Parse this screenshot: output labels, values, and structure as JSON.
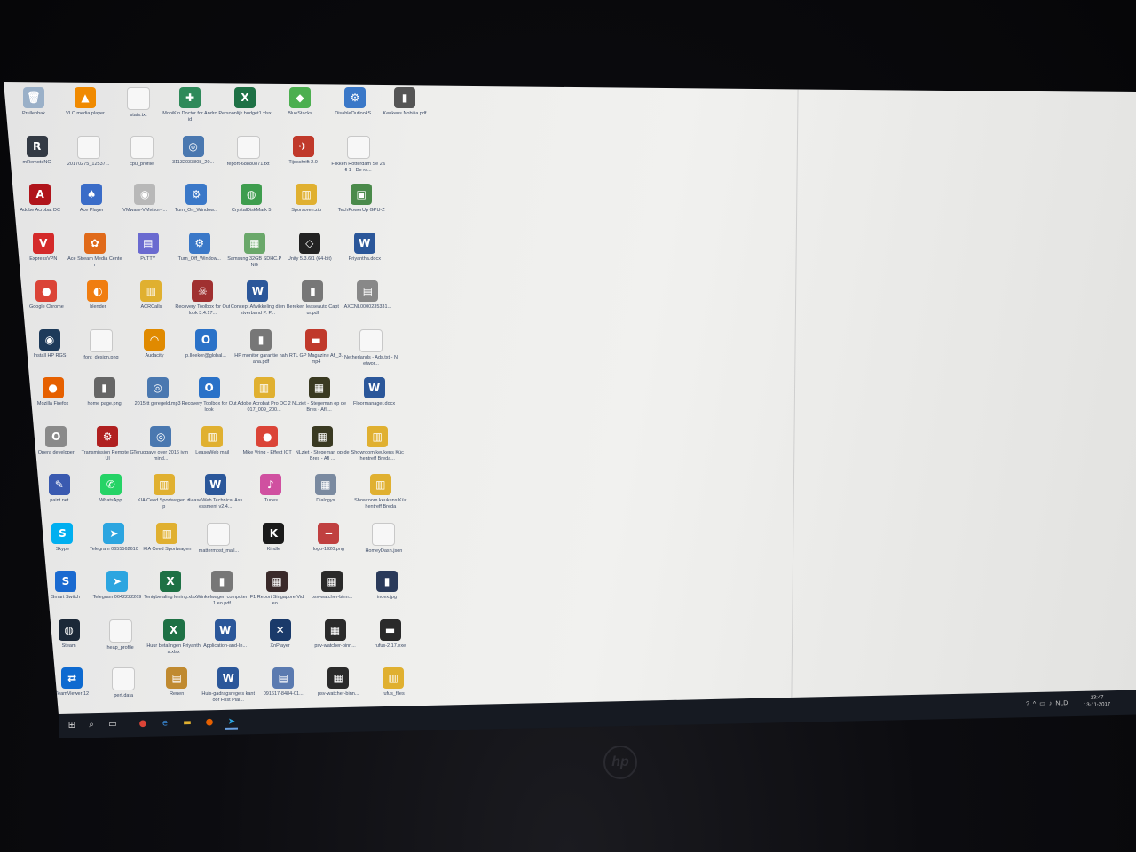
{
  "desktop": {
    "icons": [
      {
        "label": "Prullenbak",
        "glyph": "🗑",
        "color": "#9ab0c8"
      },
      {
        "label": "VLC media player",
        "glyph": "▲",
        "color": "#f08a00"
      },
      {
        "label": "stats.txt",
        "glyph": "",
        "color": "#d8d8d8"
      },
      {
        "label": "MobiKin Doctor for Android",
        "glyph": "✚",
        "color": "#2f8a5a"
      },
      {
        "label": "Persoonlijk budget1.xlsx",
        "glyph": "X",
        "color": "#1e7145"
      },
      {
        "label": "BlueStacks",
        "glyph": "◆",
        "color": "#4caf50"
      },
      {
        "label": "DisableOutlookS...",
        "glyph": "⚙",
        "color": "#3a78c8"
      },
      {
        "label": "Keukens Nobilia.pdf",
        "glyph": "▮",
        "color": "#555555"
      },
      {
        "label": "mRemoteNG",
        "glyph": "R",
        "color": "#333a44"
      },
      {
        "label": "20170275_12537...",
        "glyph": "",
        "color": "#bdbdbd"
      },
      {
        "label": "cpu_profile",
        "glyph": "",
        "color": "#d8d8d8"
      },
      {
        "label": "31132033808_20...",
        "glyph": "◎",
        "color": "#4a78b0"
      },
      {
        "label": "report-68880871.txt",
        "glyph": "",
        "color": "#d8d8d8"
      },
      {
        "label": "Tijdschrift 2.0",
        "glyph": "✈",
        "color": "#c0392b"
      },
      {
        "label": "Flikken Rotterdam Se 2afl 1 - De ra...",
        "glyph": "",
        "color": "#d8d8d8"
      },
      {
        "label": "Adobe Acrobat DC",
        "glyph": "A",
        "color": "#b0141b"
      },
      {
        "label": "Ace Player",
        "glyph": "♠",
        "color": "#3a6cc8"
      },
      {
        "label": "VMware-VMvisor-I...",
        "glyph": "◉",
        "color": "#b8b8b8"
      },
      {
        "label": "Turn_On_Window...",
        "glyph": "⚙",
        "color": "#3a78c8"
      },
      {
        "label": "CrystalDiskMark 5",
        "glyph": "◍",
        "color": "#3e9d4e"
      },
      {
        "label": "Sporsoren.zip",
        "glyph": "▥",
        "color": "#e0b030"
      },
      {
        "label": "TechPowerUp GPU-Z",
        "glyph": "▣",
        "color": "#4a8a4a"
      },
      {
        "label": "ExpressVPN",
        "glyph": "V",
        "color": "#d42a2a"
      },
      {
        "label": "Ace Stream Media Center",
        "glyph": "✿",
        "color": "#e06a1a"
      },
      {
        "label": "PuTTY",
        "glyph": "▤",
        "color": "#6a6ad0"
      },
      {
        "label": "Turn_Off_Window...",
        "glyph": "⚙",
        "color": "#3a78c8"
      },
      {
        "label": "Samsung 32GB SDHC.PNG",
        "glyph": "▦",
        "color": "#6aa86a"
      },
      {
        "label": "Unity 5.3.6f1 (64-bit)",
        "glyph": "◇",
        "color": "#222222"
      },
      {
        "label": "Priyantha.docx",
        "glyph": "W",
        "color": "#2b579a"
      },
      {
        "label": "Google Chrome",
        "glyph": "●",
        "color": "#db4437"
      },
      {
        "label": "blender",
        "glyph": "◐",
        "color": "#f07d10"
      },
      {
        "label": "ACRCalls",
        "glyph": "▥",
        "color": "#e0b030"
      },
      {
        "label": "Recovery Toolbox for Outlook 3.4.17...",
        "glyph": "☠",
        "color": "#a03030"
      },
      {
        "label": "Concept Afwikkeling dienstverband P. P...",
        "glyph": "W",
        "color": "#2b579a"
      },
      {
        "label": "Bereken leaseauto Captur.pdf",
        "glyph": "▮",
        "color": "#777777"
      },
      {
        "label": "AXCNL0000235331...",
        "glyph": "▤",
        "color": "#888888"
      },
      {
        "label": "Install HP RGS",
        "glyph": "◉",
        "color": "#1d3a5a"
      },
      {
        "label": "font_design.png",
        "glyph": "",
        "color": "#cfcfcf"
      },
      {
        "label": "Audacity",
        "glyph": "◠",
        "color": "#e08a00"
      },
      {
        "label": "p.Ileeker@global...",
        "glyph": "O",
        "color": "#2a72c8"
      },
      {
        "label": "HP monitor garantie hahaha.pdf",
        "glyph": "▮",
        "color": "#777777"
      },
      {
        "label": "RTL GP Magazine Afl_3.mp4",
        "glyph": "▬",
        "color": "#c0392b"
      },
      {
        "label": "Netherlands - Ads.txt - Networ...",
        "glyph": "",
        "color": "#d8d8d8"
      },
      {
        "label": "Mozilla Firefox",
        "glyph": "●",
        "color": "#e66000"
      },
      {
        "label": "home page.png",
        "glyph": "▮",
        "color": "#666666"
      },
      {
        "label": "2015 tt geregeld.mp3",
        "glyph": "◎",
        "color": "#4a78b0"
      },
      {
        "label": "Recovery Toolbox for Outlook",
        "glyph": "O",
        "color": "#2a72c8"
      },
      {
        "label": "Adobe Acrobat Pro DC 2017_009_200...",
        "glyph": "▥",
        "color": "#e0b030"
      },
      {
        "label": "NLziet - Stegeman op de Bres - Afl ...",
        "glyph": "▦",
        "color": "#3a3a22"
      },
      {
        "label": "Floormanager.docx",
        "glyph": "W",
        "color": "#2b579a"
      },
      {
        "label": "Opera developer",
        "glyph": "O",
        "color": "#8a8a8a"
      },
      {
        "label": "Transmission Remote GUI",
        "glyph": "⚙",
        "color": "#b02020"
      },
      {
        "label": "Teruggave over 2016 ivm mind...",
        "glyph": "◎",
        "color": "#4a78b0"
      },
      {
        "label": "LeaseWeb mail",
        "glyph": "▥",
        "color": "#e0b030"
      },
      {
        "label": "Mike Vring - Effect ICT",
        "glyph": "●",
        "color": "#db4437"
      },
      {
        "label": "NLziet - Stegeman op de Bres - Afl ...",
        "glyph": "▦",
        "color": "#3a3a22"
      },
      {
        "label": "Showroom keukens Küchentreff Breda...",
        "glyph": "▥",
        "color": "#e0b030"
      },
      {
        "label": "paint.net",
        "glyph": "✎",
        "color": "#3a5ab0"
      },
      {
        "label": "WhatsApp",
        "glyph": "✆",
        "color": "#25d366"
      },
      {
        "label": "KIA Ceed Sportwagen.zip",
        "glyph": "▥",
        "color": "#e0b030"
      },
      {
        "label": "LeaseWeb Technical Assessment v2.4...",
        "glyph": "W",
        "color": "#2b579a"
      },
      {
        "label": "iTunes",
        "glyph": "♪",
        "color": "#d050a0"
      },
      {
        "label": "Dialogys",
        "glyph": "▦",
        "color": "#7a8aa0"
      },
      {
        "label": "Showroom keukens Küchentreff Breda",
        "glyph": "▥",
        "color": "#e0b030"
      },
      {
        "label": "Skype",
        "glyph": "S",
        "color": "#00aff0"
      },
      {
        "label": "Telegram 0655562610",
        "glyph": "➤",
        "color": "#2ca5e0"
      },
      {
        "label": "KIA Ceed Sportwagen",
        "glyph": "▥",
        "color": "#e0b030"
      },
      {
        "label": "mattermost_mail...",
        "glyph": "",
        "color": "#d8d8d8"
      },
      {
        "label": "Kindle",
        "glyph": "K",
        "color": "#1a1a1a"
      },
      {
        "label": "logo-1920.png",
        "glyph": "━",
        "color": "#c04040"
      },
      {
        "label": "HomeyDash.json",
        "glyph": "",
        "color": "#d8d8d8"
      },
      {
        "label": "Smart Switch",
        "glyph": "S",
        "color": "#1a6ad0"
      },
      {
        "label": "Telegram 0642222269",
        "glyph": "➤",
        "color": "#2ca5e0"
      },
      {
        "label": "Tenigbetaling lening.xlsx",
        "glyph": "X",
        "color": "#1e7145"
      },
      {
        "label": "Winkelwagen computer 1.eo.pdf",
        "glyph": "▮",
        "color": "#777777"
      },
      {
        "label": "F1 Report Singapore Video...",
        "glyph": "▦",
        "color": "#3a2a2a"
      },
      {
        "label": "psv-watcher-binn...",
        "glyph": "▦",
        "color": "#2a2a2a"
      },
      {
        "label": "index.jpg",
        "glyph": "▮",
        "color": "#2a3a5a"
      },
      {
        "label": "Steam",
        "glyph": "◍",
        "color": "#1b2838"
      },
      {
        "label": "heap_profile",
        "glyph": "",
        "color": "#d8d8d8"
      },
      {
        "label": "Huur betalingen Priyantha.xlsx",
        "glyph": "X",
        "color": "#1e7145"
      },
      {
        "label": "Application-and-In...",
        "glyph": "W",
        "color": "#2b579a"
      },
      {
        "label": "XnPlayer",
        "glyph": "✕",
        "color": "#1a3a6a"
      },
      {
        "label": "psv-watcher-binn...",
        "glyph": "▦",
        "color": "#2a2a2a"
      },
      {
        "label": "rufus-2.17.exe",
        "glyph": "▬",
        "color": "#2a2a2a"
      },
      {
        "label": "TeamViewer 12",
        "glyph": "⇄",
        "color": "#0e6ad0"
      },
      {
        "label": "perf.data",
        "glyph": "",
        "color": "#d8d8d8"
      },
      {
        "label": "Reuen",
        "glyph": "▤",
        "color": "#c08a30"
      },
      {
        "label": "Huis-gadragsregels kantoor Frist Plai...",
        "glyph": "W",
        "color": "#2b579a"
      },
      {
        "label": "091617-8484-01...",
        "glyph": "▤",
        "color": "#5a7ab0"
      },
      {
        "label": "psv-watcher-binn...",
        "glyph": "▦",
        "color": "#2a2a2a"
      },
      {
        "label": "rufus_files",
        "glyph": "▥",
        "color": "#e0b030"
      }
    ]
  },
  "taskbar": {
    "start": "⊞",
    "search": "⌕",
    "taskview": "▭",
    "apps": [
      {
        "name": "chrome",
        "glyph": "●",
        "color": "#db4437"
      },
      {
        "name": "edge",
        "glyph": "e",
        "color": "#3a8ad8"
      },
      {
        "name": "explorer",
        "glyph": "▬",
        "color": "#e0b030"
      },
      {
        "name": "firefox",
        "glyph": "●",
        "color": "#e66000"
      },
      {
        "name": "telegram",
        "glyph": "➤",
        "color": "#2ca5e0"
      }
    ],
    "tray": [
      "?",
      "^",
      "▭",
      "♪",
      "NLD"
    ],
    "clock_time": "13:47",
    "clock_date": "13-11-2017"
  },
  "brand": "hp"
}
